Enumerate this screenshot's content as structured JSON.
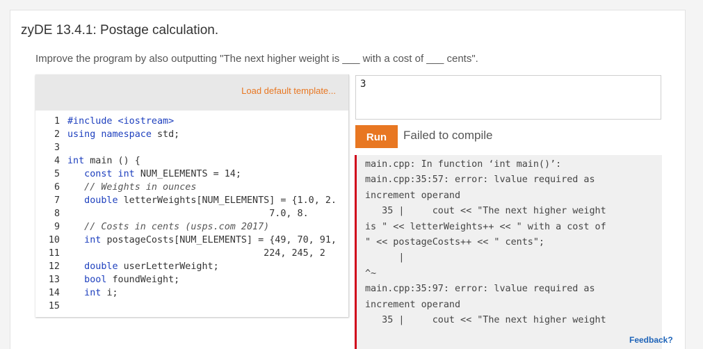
{
  "header": {
    "title": "zyDE 13.4.1: Postage calculation.",
    "instructions": "Improve the program by also outputting \"The next higher weight is ___ with a cost of ___ cents\"."
  },
  "editor": {
    "load_template_label": "Load default template...",
    "lines": [
      {
        "num": "1",
        "parts": [
          {
            "t": "#include <iostream>",
            "c": "kw"
          }
        ]
      },
      {
        "num": "2",
        "parts": [
          {
            "t": "using namespace ",
            "c": "kw"
          },
          {
            "t": "std;",
            "c": "kw2"
          }
        ]
      },
      {
        "num": "3",
        "parts": []
      },
      {
        "num": "4",
        "parts": [
          {
            "t": "int",
            "c": "kw"
          },
          {
            "t": " main () {",
            "c": "kw2"
          }
        ]
      },
      {
        "num": "5",
        "parts": [
          {
            "t": "   const int ",
            "c": "kw"
          },
          {
            "t": "NUM_ELEMENTS = 14;",
            "c": "kw2"
          }
        ]
      },
      {
        "num": "6",
        "parts": [
          {
            "t": "   // Weights in ounces",
            "c": "cm"
          }
        ]
      },
      {
        "num": "7",
        "parts": [
          {
            "t": "   double ",
            "c": "kw"
          },
          {
            "t": "letterWeights[NUM_ELEMENTS] = {1.0, 2.",
            "c": "kw2"
          }
        ]
      },
      {
        "num": "8",
        "parts": [
          {
            "t": "                                    7.0, 8.",
            "c": "kw2"
          }
        ]
      },
      {
        "num": "9",
        "parts": [
          {
            "t": "   // Costs in cents (usps.com 2017)",
            "c": "cm"
          }
        ]
      },
      {
        "num": "10",
        "parts": [
          {
            "t": "   int ",
            "c": "kw"
          },
          {
            "t": "postageCosts[NUM_ELEMENTS] = {49, 70, 91,",
            "c": "kw2"
          }
        ]
      },
      {
        "num": "11",
        "parts": [
          {
            "t": "                                   224, 245, 2",
            "c": "kw2"
          }
        ]
      },
      {
        "num": "12",
        "parts": [
          {
            "t": "   double ",
            "c": "kw"
          },
          {
            "t": "userLetterWeight;",
            "c": "kw2"
          }
        ]
      },
      {
        "num": "13",
        "parts": [
          {
            "t": "   bool ",
            "c": "kw"
          },
          {
            "t": "foundWeight;",
            "c": "kw2"
          }
        ]
      },
      {
        "num": "14",
        "parts": [
          {
            "t": "   int ",
            "c": "kw"
          },
          {
            "t": "i;",
            "c": "kw2"
          }
        ]
      },
      {
        "num": "15",
        "parts": []
      }
    ]
  },
  "input": {
    "value": "3"
  },
  "run": {
    "label": "Run",
    "status": "Failed to compile"
  },
  "output": {
    "lines": [
      "main.cpp: In function ‘int main()’:",
      "main.cpp:35:57: error: lvalue required as",
      "increment operand",
      "   35 |     cout << \"The next higher weight",
      "is \" << letterWeights++ << \" with a cost of",
      "\" << postageCosts++ << \" cents\";",
      "      |",
      "^~",
      "main.cpp:35:97: error: lvalue required as",
      "increment operand",
      "   35 |     cout << \"The next higher weight"
    ]
  },
  "footer": {
    "feedback_label": "Feedback?"
  },
  "colors": {
    "accent": "#e87722",
    "error_bar": "#d0021b",
    "keyword": "#1d3fbe",
    "link": "#1d63b8"
  }
}
